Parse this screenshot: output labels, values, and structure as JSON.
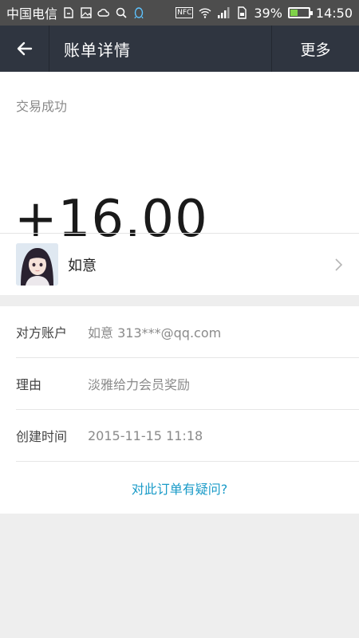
{
  "status_bar": {
    "carrier": "中国电信",
    "battery_percent": "39%",
    "battery_level": 0.39,
    "time": "14:50",
    "nfc_label": "NFC",
    "icons": [
      "sim-icon",
      "image-icon",
      "cloud-icon",
      "search-icon",
      "qq-icon",
      "nfc-icon",
      "wifi-icon",
      "signal-icon",
      "sim-card-icon",
      "battery-icon"
    ]
  },
  "header": {
    "title": "账单详情",
    "more_label": "更多",
    "back_icon": "back-arrow-icon"
  },
  "transaction": {
    "status": "交易成功",
    "amount": "+16.00"
  },
  "counterparty": {
    "name": "如意",
    "chevron_icon": "chevron-right-icon"
  },
  "details": [
    {
      "label": "对方账户",
      "value": "如意 313***@qq.com"
    },
    {
      "label": "理由",
      "value": "淡雅给力会员奖励"
    },
    {
      "label": "创建时间",
      "value": "2015-11-15 11:18"
    }
  ],
  "question_link": "对此订单有疑问?",
  "colors": {
    "status_bar": "#4d4d4d",
    "header": "#2f3540",
    "link": "#1a9bc8",
    "battery_fill": "#7fd14a"
  }
}
